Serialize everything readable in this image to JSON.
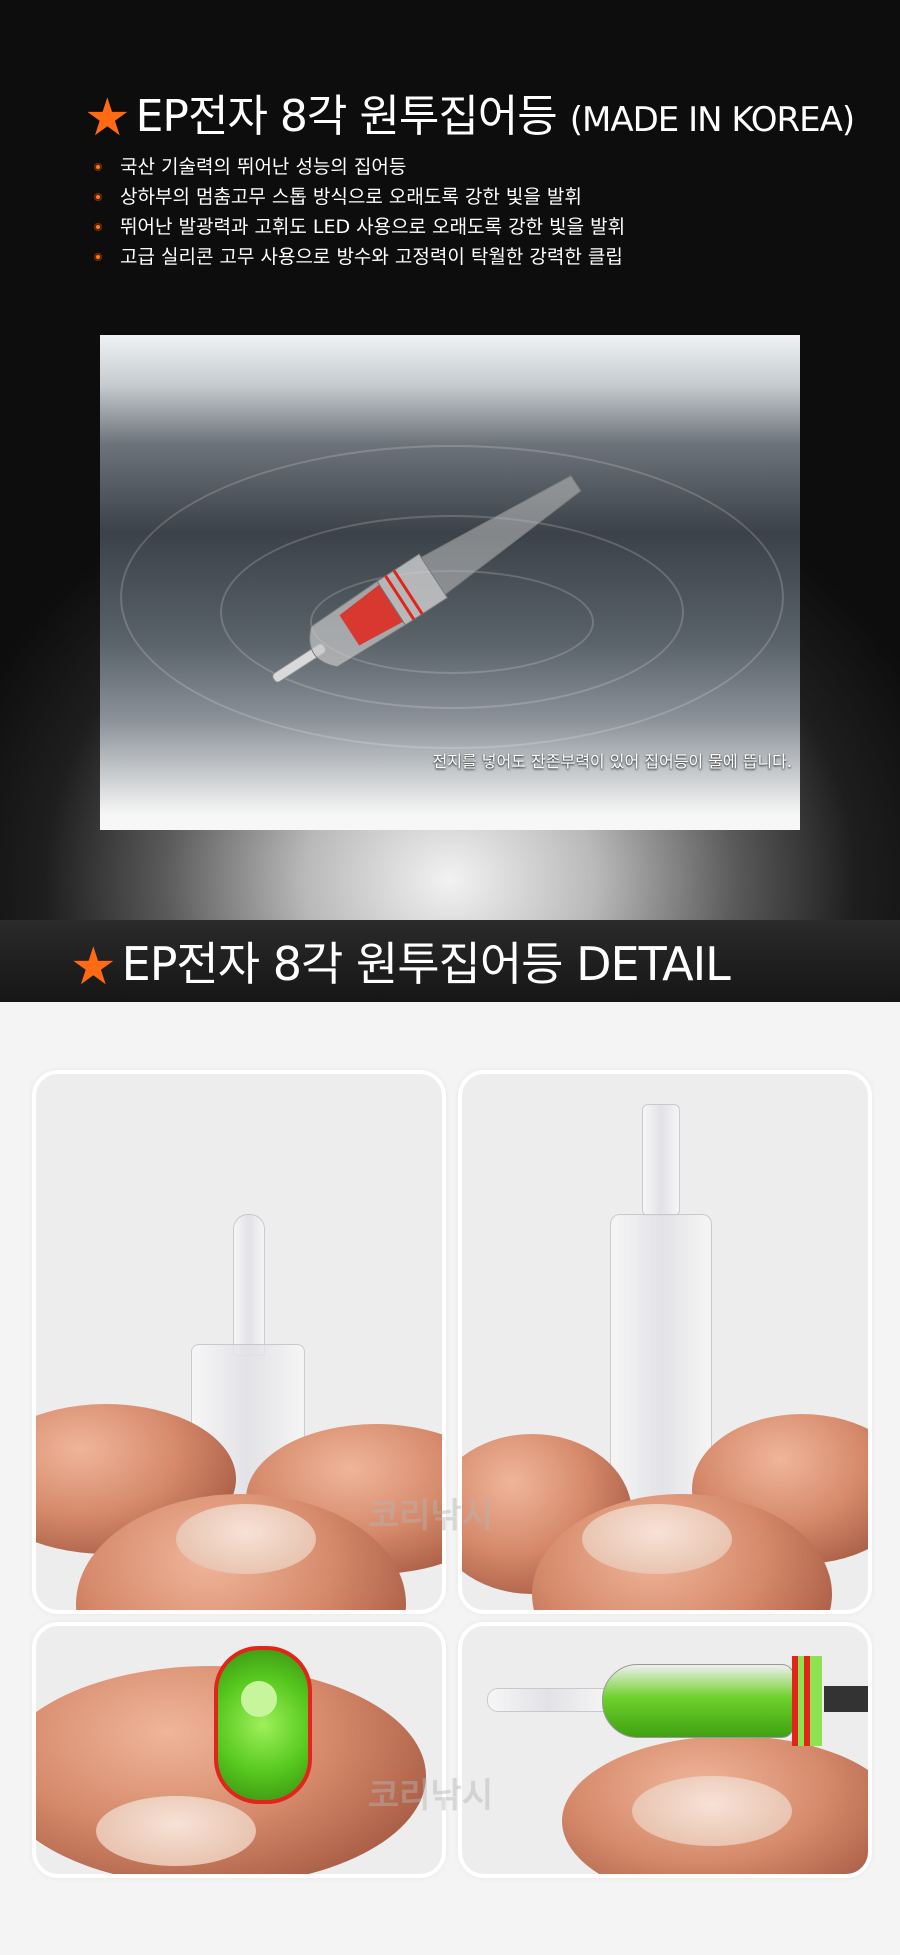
{
  "header": {
    "title_main": "EP전자 8각 원투집어등",
    "title_sub": "(MADE IN KOREA)",
    "star": "★",
    "accent_color": "#ff6a14"
  },
  "features": [
    "국산 기술력의 뛰어난 성능의 집어등",
    "상하부의 멈춤고무 스톱 방식으로 오래도록 강한 빛을 발휘",
    "뛰어난 발광력과 고휘도  LED 사용으로 오래도록 강한 빛을 발휘",
    "고급 실리콘 고무 사용으로 방수와 고정력이 탁월한 강력한 클립"
  ],
  "hero": {
    "caption": "전지를 넣어도 잔존부력이 있어 집어등이 물에 뜹니다."
  },
  "detail": {
    "title": "EP전자 8각 원투집어등 DETAIL",
    "star": "★"
  },
  "watermark": "코리낚시"
}
